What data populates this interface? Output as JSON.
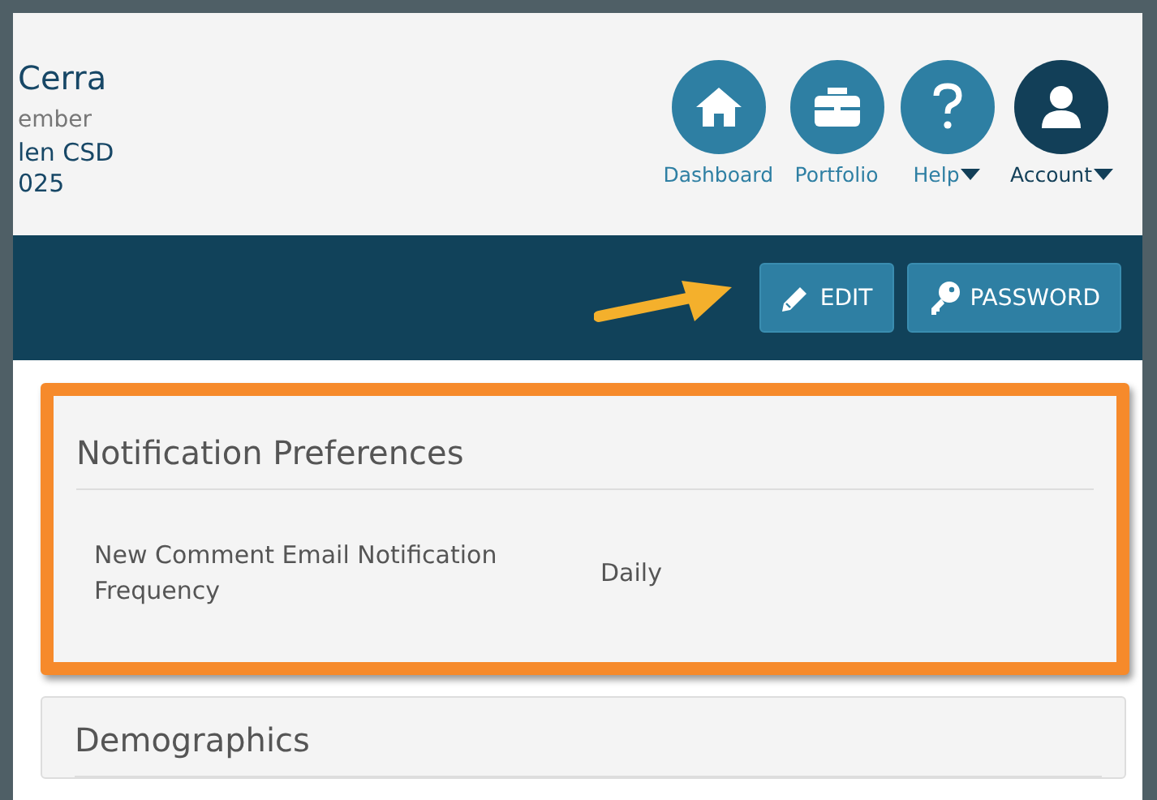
{
  "profile": {
    "name": "Cerra",
    "role": "ember",
    "district": "len CSD",
    "year": "025"
  },
  "nav": [
    {
      "kind": "home",
      "label": "Dashboard",
      "selected": false,
      "dropdown": false
    },
    {
      "kind": "briefcase",
      "label": "Portfolio",
      "selected": false,
      "dropdown": false
    },
    {
      "kind": "help",
      "label": "Help",
      "selected": false,
      "dropdown": true
    },
    {
      "kind": "user",
      "label": "Account",
      "selected": true,
      "dropdown": true
    }
  ],
  "toolbar": {
    "buttons": [
      {
        "kind": "edit",
        "label": "EDIT"
      },
      {
        "kind": "key",
        "label": "PASSWORD"
      }
    ]
  },
  "sections": [
    {
      "title": "Notification Preferences",
      "highlighted": true,
      "rows": [
        {
          "label": "New Comment Email Notification Frequency",
          "value": "Daily"
        }
      ]
    },
    {
      "title": "Demographics",
      "highlighted": false
    }
  ]
}
